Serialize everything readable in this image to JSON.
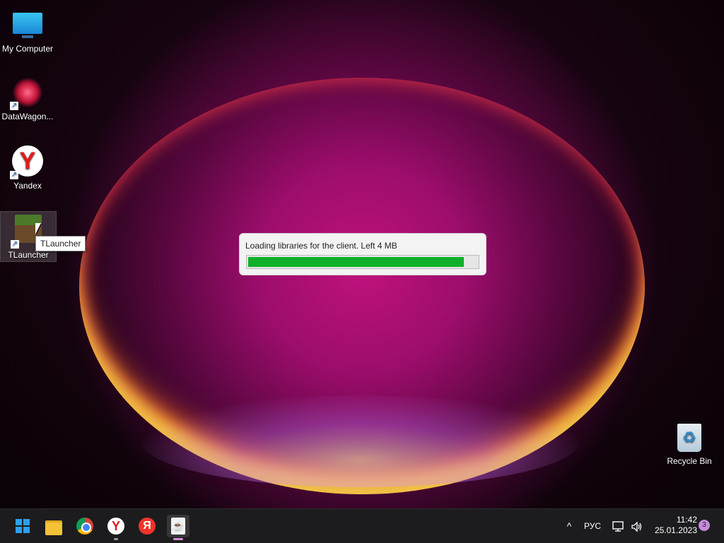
{
  "desktop": {
    "icons": [
      {
        "label": "My Computer",
        "icon": "monitor-icon"
      },
      {
        "label": "DataWagon...",
        "icon": "datawagon-icon"
      },
      {
        "label": "Yandex",
        "icon": "yandex-icon"
      },
      {
        "label": "TLauncher",
        "icon": "tlauncher-icon"
      },
      {
        "label": "Recycle Bin",
        "icon": "recycle-bin-icon"
      }
    ],
    "tooltip": "TLauncher"
  },
  "dialog": {
    "message": "Loading libraries for the client. Left 4 MB",
    "progress_fraction": 0.94,
    "progress_color": "#0fb02a"
  },
  "taskbar": {
    "apps": [
      {
        "name": "Start",
        "icon": "windows-logo-icon"
      },
      {
        "name": "File Explorer",
        "icon": "folder-icon"
      },
      {
        "name": "Google Chrome",
        "icon": "chrome-icon"
      },
      {
        "name": "Yandex Browser",
        "icon": "yandex-browser-icon",
        "glyph": "Y"
      },
      {
        "name": "Yandex",
        "icon": "yandex-icon",
        "glyph": "Я"
      },
      {
        "name": "Java",
        "icon": "java-icon",
        "glyph": "☕"
      }
    ],
    "tray": {
      "chevron": "^",
      "language": "РУС",
      "network_icon": "network-icon",
      "volume_icon": "volume-icon",
      "time": "11:42",
      "date": "25.01.2023",
      "notifications": "3"
    }
  }
}
